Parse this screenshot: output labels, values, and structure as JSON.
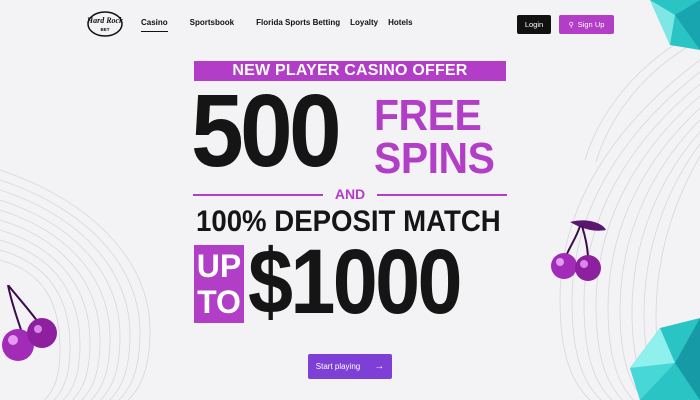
{
  "logo": {
    "line1": "Hard Rock",
    "line2": "BET"
  },
  "nav": {
    "links": [
      {
        "label": "Casino",
        "active": true
      },
      {
        "label": "Sportsbook",
        "active": false
      },
      {
        "label": "Florida Sports Betting",
        "active": false
      },
      {
        "label": "Loyalty",
        "active": false
      },
      {
        "label": "Hotels",
        "active": false
      }
    ],
    "login_label": "Login",
    "signup_label": "Sign Up",
    "signup_icon": "pin-icon"
  },
  "hero": {
    "banner": "NEW PLAYER CASINO OFFER",
    "spins_count": "500",
    "free": "FREE",
    "spins": "SPINS",
    "and": "AND",
    "deposit_match": "100% DEPOSIT MATCH",
    "up": "UP",
    "to": "TO",
    "amount": "$1000",
    "cta_label": "Start playing",
    "cta_icon": "arrow-right-icon"
  },
  "colors": {
    "accent": "#b23dc6",
    "cta": "#7d3fd6",
    "dark": "#151515",
    "background": "#f3f3f6"
  }
}
